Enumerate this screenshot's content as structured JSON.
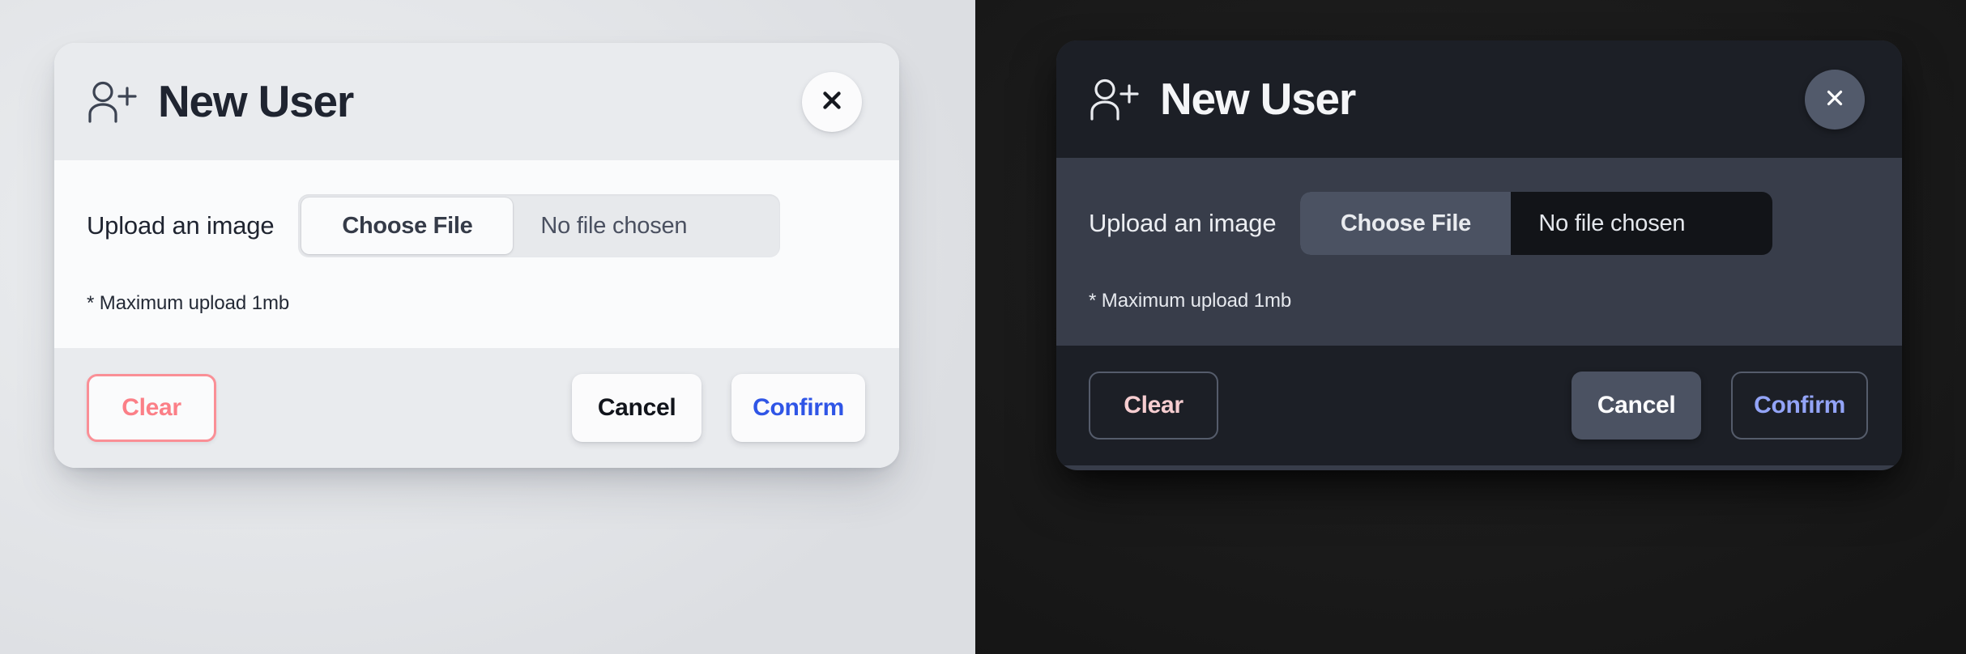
{
  "dialog": {
    "title": "New User",
    "title_icon": "user-plus-icon",
    "close_icon": "close-icon",
    "close_label": "×",
    "upload_label": "Upload an image",
    "choose_file_label": "Choose File",
    "file_name": "No file chosen",
    "hint": "* Maximum upload 1mb",
    "buttons": {
      "clear": "Clear",
      "cancel": "Cancel",
      "confirm": "Confirm"
    }
  },
  "themes": {
    "light": {
      "name": "light",
      "page_background": "#e4e6e9",
      "panel_background": "#fafbfc",
      "header_background": "#e9ebee",
      "footer_background": "#e9ebee",
      "title_color": "#1f2430",
      "clear_color": "#fb7f87",
      "cancel_color": "#11141b",
      "confirm_color": "#2f55e6"
    },
    "dark": {
      "name": "dark",
      "page_background": "#1a1a1a",
      "panel_background": "#383d4a",
      "header_background": "#1c1f26",
      "footer_background": "#1c1f26",
      "title_color": "#f4f5f7",
      "clear_color": "#f6cdd0",
      "cancel_color": "#fdfdfe",
      "confirm_color": "#93a4f7"
    }
  }
}
